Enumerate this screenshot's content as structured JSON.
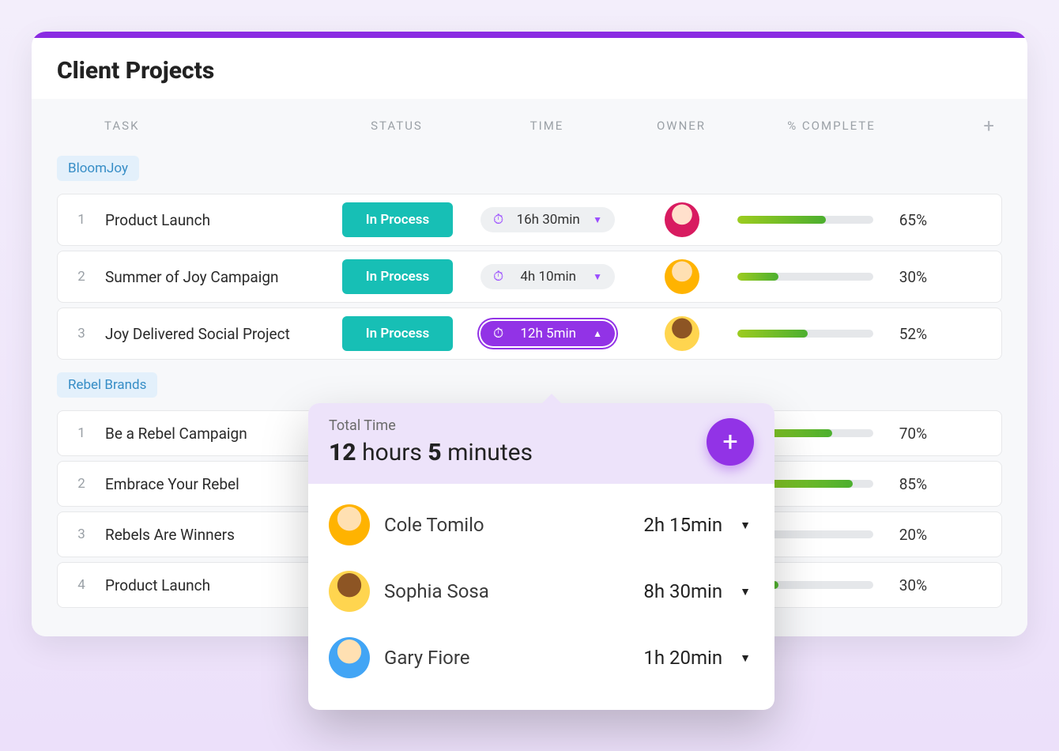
{
  "pageTitle": "Client Projects",
  "columns": {
    "task": "TASK",
    "status": "STATUS",
    "time": "TIME",
    "owner": "OWNER",
    "pct": "% COMPLETE"
  },
  "groups": [
    {
      "name": "BloomJoy",
      "rows": [
        {
          "idx": "1",
          "task": "Product Launch",
          "status": "In Process",
          "time": "16h 30min",
          "pct": 65,
          "pctLabel": "65%",
          "avatar": "av1",
          "active": false
        },
        {
          "idx": "2",
          "task": "Summer of Joy Campaign",
          "status": "In Process",
          "time": "4h 10min",
          "pct": 30,
          "pctLabel": "30%",
          "avatar": "av2",
          "active": false
        },
        {
          "idx": "3",
          "task": "Joy Delivered Social Project",
          "status": "In Process",
          "time": "12h 5min",
          "pct": 52,
          "pctLabel": "52%",
          "avatar": "av3",
          "active": true
        }
      ]
    },
    {
      "name": "Rebel Brands",
      "rows": [
        {
          "idx": "1",
          "task": "Be a Rebel Campaign",
          "status": "",
          "time": "",
          "pct": 70,
          "pctLabel": "70%",
          "avatar": "",
          "active": false
        },
        {
          "idx": "2",
          "task": "Embrace Your Rebel",
          "status": "",
          "time": "",
          "pct": 85,
          "pctLabel": "85%",
          "avatar": "",
          "active": false
        },
        {
          "idx": "3",
          "task": "Rebels Are Winners",
          "status": "",
          "time": "",
          "pct": 20,
          "pctLabel": "20%",
          "avatar": "",
          "active": false
        },
        {
          "idx": "4",
          "task": "Product Launch",
          "status": "",
          "time": "",
          "pct": 30,
          "pctLabel": "30%",
          "avatar": "",
          "active": false
        }
      ]
    }
  ],
  "popover": {
    "totalLabel": "Total Time",
    "total": {
      "hours": "12",
      "hoursUnit": "hours",
      "minutes": "5",
      "minutesUnit": "minutes"
    },
    "entries": [
      {
        "name": "Cole Tomilo",
        "time": "2h 15min",
        "avatar": "av2"
      },
      {
        "name": "Sophia Sosa",
        "time": "8h 30min",
        "avatar": "av3"
      },
      {
        "name": "Gary Fiore",
        "time": "1h 20min",
        "avatar": "av4"
      }
    ]
  },
  "colors": {
    "accent": "#8a2be2",
    "statusTeal": "#17bfb5",
    "chipBlue": "#e3f0fb"
  }
}
